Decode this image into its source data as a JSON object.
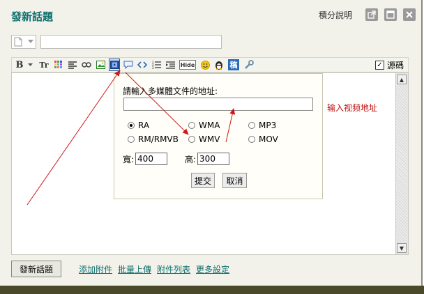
{
  "window": {
    "title": "發新話題",
    "help_link": "積分說明",
    "controls": [
      "popout-icon",
      "maximize-icon",
      "close-icon"
    ]
  },
  "subject": {
    "type_icon": "document-icon",
    "value": ""
  },
  "toolbar": {
    "bold": "B",
    "font_size": "Tr",
    "hide": "Hide",
    "quote": "稿",
    "source_label": "源碼",
    "source_checked": true
  },
  "media_dialog": {
    "prompt": "請輸入多媒體文件的地址:",
    "url_value": "",
    "formats": [
      {
        "label": "RA",
        "selected": true
      },
      {
        "label": "WMA",
        "selected": false
      },
      {
        "label": "MP3",
        "selected": false
      },
      {
        "label": "RM/RMVB",
        "selected": false
      },
      {
        "label": "WMV",
        "selected": false
      },
      {
        "label": "MOV",
        "selected": false
      }
    ],
    "width_label": "寬:",
    "width_value": "400",
    "height_label": "高:",
    "height_value": "300",
    "submit_label": "提交",
    "cancel_label": "取消"
  },
  "annotation": {
    "note": "输入视频地址",
    "color": "#c01010"
  },
  "footer": {
    "submit_label": "發新話題",
    "links": [
      "添加附件",
      "批量上傳",
      "附件列表",
      "更多設定"
    ]
  },
  "colors": {
    "title": "#0d6f6f",
    "arrow": "#d01818"
  }
}
